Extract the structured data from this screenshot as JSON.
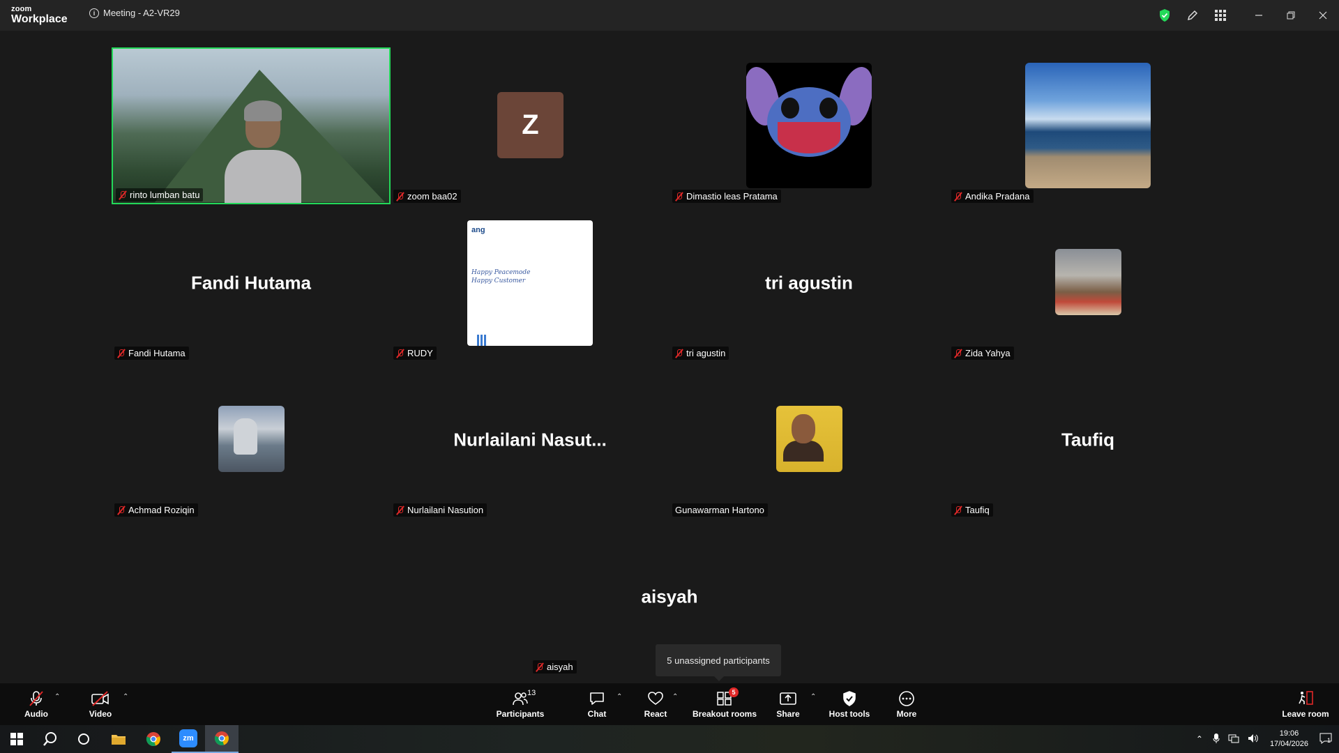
{
  "titlebar": {
    "brand_top": "zoom",
    "brand_bottom": "Workplace",
    "meeting_title": "Meeting - A2-VR29"
  },
  "participants": [
    {
      "name": "rinto lumban batu",
      "display": "video",
      "muted": true,
      "active_speaker": true
    },
    {
      "name": "zoom baa02",
      "display": "initial",
      "initial": "Z",
      "muted": true
    },
    {
      "name": "Dimastio leas Pratama",
      "display": "avatar",
      "muted": true
    },
    {
      "name": "Andika Pradana",
      "display": "avatar",
      "muted": true
    },
    {
      "name": "Fandi Hutama",
      "display": "name",
      "big_name": "Fandi Hutama",
      "muted": true
    },
    {
      "name": "RUDY",
      "display": "avatar",
      "muted": true,
      "poster_logo": "ang",
      "poster_text_1": "Happy Peacemode",
      "poster_text_2": "Happy Customer"
    },
    {
      "name": "tri agustin",
      "display": "name",
      "big_name": "tri agustin",
      "muted": true
    },
    {
      "name": "Zida Yahya",
      "display": "avatar",
      "muted": true
    },
    {
      "name": "Achmad Roziqin",
      "display": "avatar",
      "muted": true
    },
    {
      "name": "Nurlailani Nasution",
      "display": "name",
      "big_name": "Nurlailani  Nasut...",
      "muted": true
    },
    {
      "name": "Gunawarman Hartono",
      "display": "avatar",
      "muted": false
    },
    {
      "name": "Taufiq",
      "display": "name",
      "big_name": "Taufiq",
      "muted": true
    },
    {
      "name": "aisyah",
      "display": "name",
      "big_name": "aisyah",
      "muted": true
    }
  ],
  "tooltip": "5 unassigned participants",
  "toolbar": {
    "audio": "Audio",
    "video": "Video",
    "participants": "Participants",
    "participants_count": "13",
    "chat": "Chat",
    "react": "React",
    "breakout": "Breakout rooms",
    "breakout_badge": "5",
    "share": "Share",
    "host_tools": "Host tools",
    "more": "More",
    "leave": "Leave room"
  },
  "taskbar": {
    "time": "19:06",
    "date": "17/04/2026",
    "notification_count": "1"
  },
  "colors": {
    "active_border": "#23d959",
    "muted_red": "#e02828",
    "shield_green": "#23d959"
  }
}
